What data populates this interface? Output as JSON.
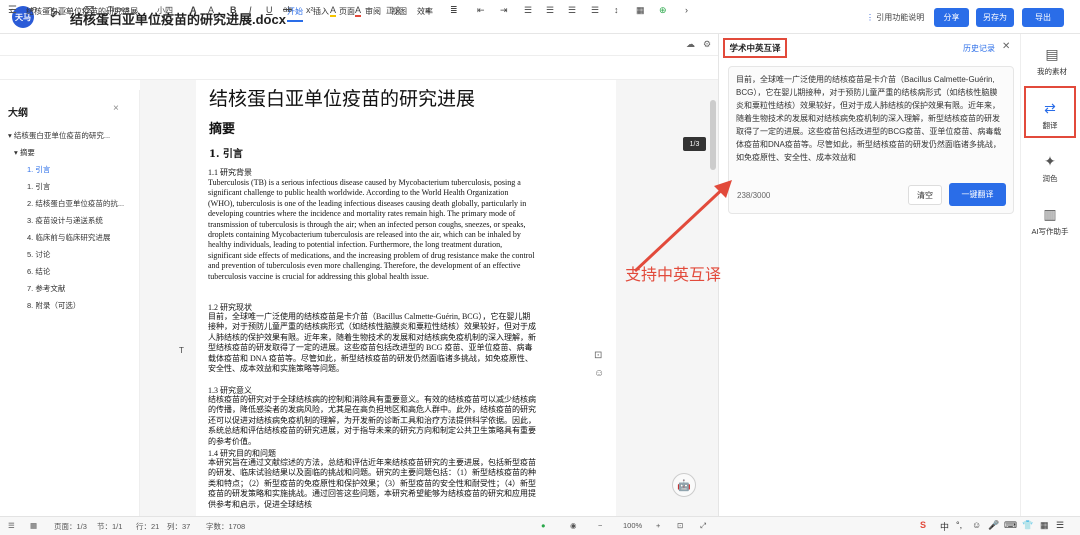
{
  "titlebar": {
    "doc_title": "结核蛋白亚单位疫苗的研究进展.docx",
    "logo_text": "天马",
    "cite_help": "引用功能说明",
    "share": "分享",
    "save_as": "另存为",
    "export": "导出"
  },
  "menubar": {
    "doc_name": "结核蛋白亚单位疫苗的研究进展",
    "tabs": [
      "开始",
      "插入",
      "页面",
      "审阅",
      "视图",
      "效率"
    ],
    "active_tab": "开始"
  },
  "format_toolbar": {
    "font": "Times ...",
    "size": "小四",
    "style": "正文",
    "buttons": [
      "B",
      "I",
      "U",
      "ab",
      "A",
      "A"
    ]
  },
  "outline": {
    "title": "大纲",
    "items": [
      {
        "label": "结核蛋白亚单位疫苗的研究...",
        "level": 0
      },
      {
        "label": "摘要",
        "level": 1
      },
      {
        "label": "1. 引言",
        "level": 2,
        "selected": true
      },
      {
        "label": "1. 引言",
        "level": 1
      },
      {
        "label": "2. 结核蛋白亚单位疫苗的抗...",
        "level": 1
      },
      {
        "label": "3. 疫苗设计与递送系统",
        "level": 1
      },
      {
        "label": "4. 临床前与临床研究进展",
        "level": 1
      },
      {
        "label": "5. 讨论",
        "level": 1
      },
      {
        "label": "6. 结论",
        "level": 1
      },
      {
        "label": "7. 参考文献",
        "level": 1
      },
      {
        "label": "8. 附录（可选）",
        "level": 1
      }
    ]
  },
  "document": {
    "title": "结核蛋白亚单位疫苗的研究进展",
    "abstract_heading": "摘要",
    "intro_heading": "1.  引言",
    "s11": "1.1 研究背景",
    "p11": "Tuberculosis (TB) is a serious infectious disease caused by Mycobacterium tuberculosis, posing a significant challenge to public health worldwide. According to the World Health Organization (WHO), tuberculosis is one of the leading infectious diseases causing death globally, particularly in developing countries where the incidence and mortality rates remain high. The primary mode of transmission of tuberculosis is through the air; when an infected person coughs, sneezes, or speaks, droplets containing Mycobacterium tuberculosis are released into the air, which can be inhaled by healthy individuals, leading to potential infection. Furthermore, the long treatment duration, significant side effects of medications, and the increasing problem of drug resistance make the control and prevention of tuberculosis even more challenging. Therefore, the development of an effective tuberculosis vaccine is crucial for addressing this global health issue.",
    "s12": "1.2 研究现状",
    "p12": "目前，全球唯一广泛使用的结核疫苗是卡介苗（Bacillus Calmette-Guérin, BCG），它在婴儿期接种，对于预防儿童严重的结核病形式（如结核性脑膜炎和粟粒性结核）效果较好，但对于成人肺结核的保护效果有限。近年来，随着生物技术的发展和对结核病免疫机制的深入理解，新型结核疫苗的研发取得了一定的进展。这些疫苗包括改进型的 BCG 疫苗、亚单位疫苗、病毒载体疫苗和 DNA 疫苗等。尽管如此，新型结核疫苗的研发仍然面临诸多挑战，如免疫原性、安全性、成本效益和实施策略等问题。",
    "s13": "1.3 研究意义",
    "p13": "结核疫苗的研究对于全球结核病的控制和消除具有重要意义。有效的结核疫苗可以减少结核病的传播，降低感染者的发病风险，尤其是在高负担地区和高危人群中。此外，结核疫苗的研究还可以促进对结核病免疫机制的理解，为开发新的诊断工具和治疗方法提供科学依据。因此，系统总结和评估结核疫苗的研究进展，对于指导未来的研究方向和制定公共卫生策略具有重要的参考价值。",
    "s14": "1.4 研究目的和问题",
    "p14": "本研究旨在通过文献综述的方法，总结和评估近年来结核疫苗研究的主要进展，包括新型疫苗的研发、临床试验结果以及面临的挑战和问题。研究的主要问题包括：（1）新型结核疫苗的种类和特点；（2）新型疫苗的免疫原性和保护效果；（3）新型疫苗的安全性和耐受性；（4）新型疫苗的研发策略和实施挑战。通过回答这些问题，本研究希望能够为结核疫苗的研究和应用提供参考和启示，促进全球结核",
    "page_tag": "1/3",
    "cursor_mark": "T"
  },
  "translate_panel": {
    "title": "学术中英互译",
    "history": "历史记录",
    "input_text": "目前，全球唯一广泛使用的结核疫苗是卡介苗（Bacillus Calmette-Guérin, BCG），它在婴儿期接种，对于预防儿童严重的结核病形式（如结核性脑膜炎和粟粒性结核）效果较好，但对于成人肺结核的保护效果有限。近年来，随着生物技术的发展和对结核病免疫机制的深入理解，新型结核疫苗的研发取得了一定的进展。这些疫苗包括改进型的BCG疫苗、亚单位疫苗、病毒载体疫苗和DNA疫苗等。尽管如此，新型结核疫苗的研发仍然面临诸多挑战，如免疫原性、安全性、成本效益和",
    "count": "238/3000",
    "clear": "清空",
    "translate": "一键翻译",
    "annotation": "支持中英互译"
  },
  "right_rail": {
    "items": [
      "我的素材",
      "翻译",
      "润色",
      "AI写作助手"
    ]
  },
  "statusbar": {
    "page": "页面：1/3",
    "section": "节：1/1",
    "row": "行：21",
    "col": "列：37",
    "words": "字数：1708",
    "zoom": "100%"
  },
  "colors": {
    "accent": "#2a6de8",
    "highlight_red": "#e24a3b"
  }
}
